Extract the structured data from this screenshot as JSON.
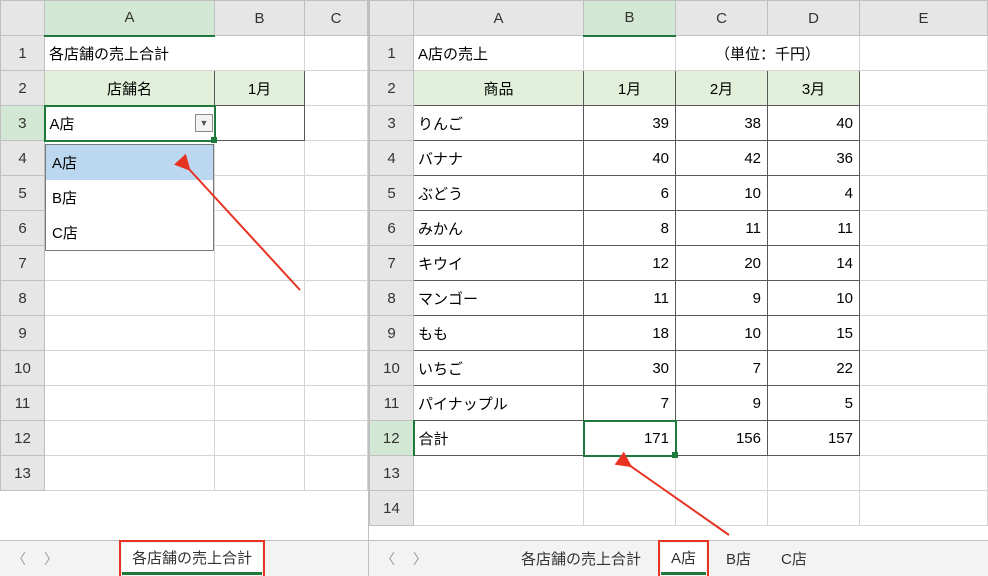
{
  "left": {
    "title": "各店舗の売上合計",
    "cols": [
      "A",
      "B",
      "C"
    ],
    "rows": [
      "1",
      "2",
      "3",
      "4",
      "5",
      "6",
      "7",
      "8",
      "9",
      "10",
      "11",
      "12",
      "13"
    ],
    "header_store": "店舗名",
    "header_month": "1月",
    "selected_store": "A店",
    "dropdown": [
      "A店",
      "B店",
      "C店"
    ],
    "tab": "各店舗の売上合計"
  },
  "right": {
    "cols": [
      "A",
      "B",
      "C",
      "D",
      "E"
    ],
    "rows": [
      "1",
      "2",
      "3",
      "4",
      "5",
      "6",
      "7",
      "8",
      "9",
      "10",
      "11",
      "12",
      "13",
      "14"
    ],
    "title": "A店の売上",
    "unit": "（単位：千円）",
    "header_prod": "商品",
    "months": [
      "1月",
      "2月",
      "3月"
    ],
    "items": [
      {
        "name": "りんご",
        "v": [
          39,
          38,
          40
        ]
      },
      {
        "name": "バナナ",
        "v": [
          40,
          42,
          36
        ]
      },
      {
        "name": "ぶどう",
        "v": [
          6,
          10,
          4
        ]
      },
      {
        "name": "みかん",
        "v": [
          8,
          11,
          11
        ]
      },
      {
        "name": "キウイ",
        "v": [
          12,
          20,
          14
        ]
      },
      {
        "name": "マンゴー",
        "v": [
          11,
          9,
          10
        ]
      },
      {
        "name": "もも",
        "v": [
          18,
          10,
          15
        ]
      },
      {
        "name": "いちご",
        "v": [
          30,
          7,
          22
        ]
      },
      {
        "name": "パイナップル",
        "v": [
          7,
          9,
          5
        ]
      }
    ],
    "total_label": "合計",
    "totals": [
      171,
      156,
      157
    ],
    "tabs": [
      "各店舗の売上合計",
      "A店",
      "B店",
      "C店"
    ]
  }
}
